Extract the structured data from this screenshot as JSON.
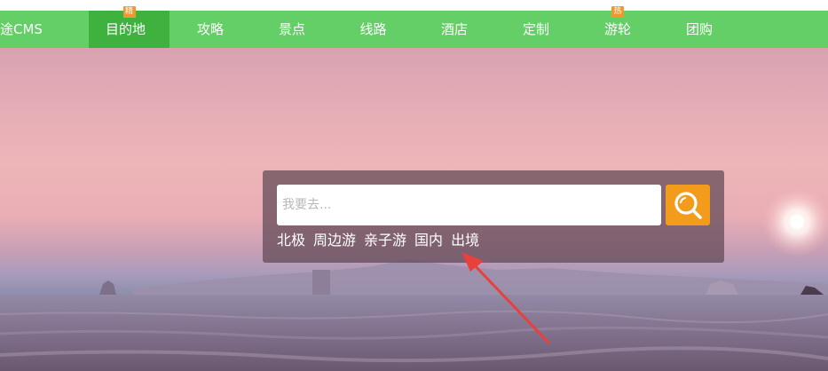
{
  "nav": {
    "items": [
      {
        "label": "途CMS",
        "active": false,
        "badge": ""
      },
      {
        "label": "目的地",
        "active": true,
        "badge": "精"
      },
      {
        "label": "攻略",
        "active": false,
        "badge": ""
      },
      {
        "label": "景点",
        "active": false,
        "badge": ""
      },
      {
        "label": "线路",
        "active": false,
        "badge": ""
      },
      {
        "label": "酒店",
        "active": false,
        "badge": ""
      },
      {
        "label": "定制",
        "active": false,
        "badge": ""
      },
      {
        "label": "游轮",
        "active": false,
        "badge": "热"
      },
      {
        "label": "团购",
        "active": false,
        "badge": ""
      }
    ]
  },
  "search": {
    "placeholder": "我要去...",
    "button_icon": "search-icon",
    "hot_links": [
      "北极",
      "周边游",
      "亲子游",
      "国内",
      "出境"
    ]
  },
  "colors": {
    "nav_bg": "#63cf66",
    "nav_active_bg": "#3fb13f",
    "badge_bg": "#f1982c",
    "search_button_bg": "#f39c1b",
    "annotation_arrow": "#e8403a"
  }
}
